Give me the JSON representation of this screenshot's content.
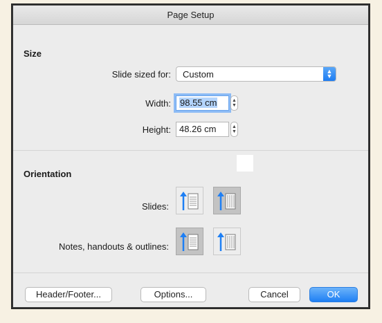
{
  "window": {
    "title": "Page Setup"
  },
  "size": {
    "section_label": "Size",
    "slide_sized_for": {
      "label": "Slide sized for:",
      "value": "Custom"
    },
    "width": {
      "label": "Width:",
      "value": "98.55 cm"
    },
    "height": {
      "label": "Height:",
      "value": "48.26 cm"
    }
  },
  "orientation": {
    "section_label": "Orientation",
    "slides": {
      "label": "Slides:",
      "selected": "landscape"
    },
    "notes": {
      "label": "Notes, handouts & outlines:",
      "selected": "portrait"
    }
  },
  "buttons": {
    "header_footer": "Header/Footer...",
    "options": "Options...",
    "cancel": "Cancel",
    "ok": "OK"
  },
  "colors": {
    "accent": "#1e7ff4",
    "selection": "#b3d4fc"
  }
}
